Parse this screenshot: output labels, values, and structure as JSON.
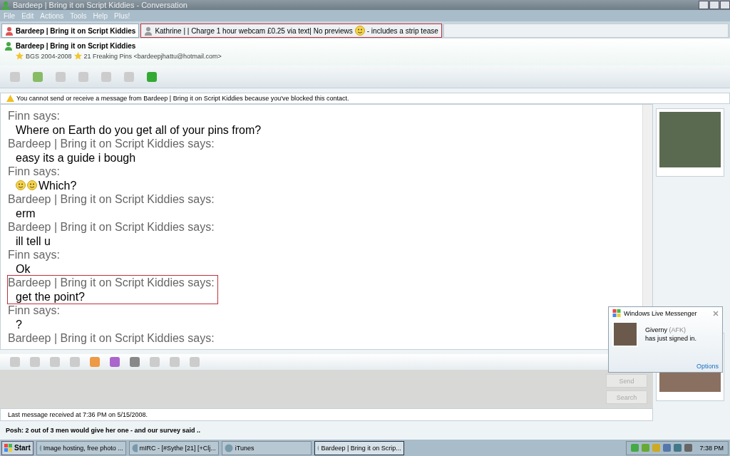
{
  "window": {
    "title": "Bardeep | Bring it on Script Kiddies - Conversation"
  },
  "menu": [
    "File",
    "Edit",
    "Actions",
    "Tools",
    "Help",
    "Plus!"
  ],
  "tabs": [
    {
      "label": "Bardeep | Bring it on Script Kiddies",
      "selected": true,
      "highlighted": false,
      "blocked": true
    },
    {
      "label": "Kathrine |  | Charge  1 hour webcam £0.25 via text| No previews ",
      "suffix": "- includes a strip tease",
      "selected": false,
      "highlighted": true,
      "blocked": false
    }
  ],
  "contact": {
    "name": "Bardeep | Bring it on Script Kiddies",
    "personal_message": "BGS 2004-2008",
    "personal_message_2": "21 Freaking Pins <bardeepjhattu@hotmail.com>"
  },
  "warning": "You cannot send or receive a message from Bardeep | Bring it on Script Kiddies because you've blocked this contact.",
  "messages": [
    {
      "sender": "Finn says:",
      "highlighted": false,
      "parts": [
        {
          "kind": "text",
          "text": "Where on Earth do you get all of your pins from?"
        }
      ]
    },
    {
      "sender": "Bardeep | Bring it on Script Kiddies says:",
      "highlighted": false,
      "parts": [
        {
          "kind": "text",
          "text": "easy its a guide i bough"
        }
      ]
    },
    {
      "sender": "Finn says:",
      "highlighted": false,
      "parts": [
        {
          "kind": "emoticon"
        },
        {
          "kind": "emoticon"
        },
        {
          "kind": "text",
          "text": "Which?"
        }
      ]
    },
    {
      "sender": "Bardeep | Bring it on Script Kiddies says:",
      "highlighted": false,
      "parts": [
        {
          "kind": "text",
          "text": "erm"
        }
      ]
    },
    {
      "sender": "Bardeep | Bring it on Script Kiddies says:",
      "highlighted": false,
      "parts": [
        {
          "kind": "text",
          "text": "ill tell u"
        }
      ]
    },
    {
      "sender": "Finn says:",
      "highlighted": false,
      "parts": [
        {
          "kind": "text",
          "text": "Ok"
        }
      ]
    },
    {
      "sender": "Bardeep | Bring it on Script Kiddies says:",
      "highlighted": true,
      "parts": [
        {
          "kind": "text",
          "text": "get the point?"
        }
      ]
    },
    {
      "sender": "Finn says:",
      "highlighted": false,
      "parts": [
        {
          "kind": "text",
          "text": "?"
        }
      ]
    },
    {
      "sender": "Bardeep | Bring it on Script Kiddies says:",
      "highlighted": false
    }
  ],
  "buttons": [
    {
      "label": "Send",
      "disabled": true
    },
    {
      "label": "Search",
      "disabled": true
    }
  ],
  "status_bar": "Last message received at 7:36 PM on 5/15/2008.",
  "ticker": "Posh:  2 out of 3 men would give her one - and our survey said ..",
  "notification": {
    "title": "Windows Live Messenger",
    "name": "Giverny",
    "status": "(AFK)",
    "text": "has just signed in.",
    "link": "Options"
  },
  "taskbar": {
    "start": "Start",
    "tasks": [
      {
        "label": "Image hosting, free photo ...",
        "selected": false
      },
      {
        "label": "mIRC - [#Sythe [21] [+Clj...",
        "selected": false
      },
      {
        "label": "iTunes",
        "selected": false
      },
      {
        "label": "Bardeep | Bring it on Scrip...",
        "selected": true
      }
    ],
    "clock": "7:38 PM"
  }
}
